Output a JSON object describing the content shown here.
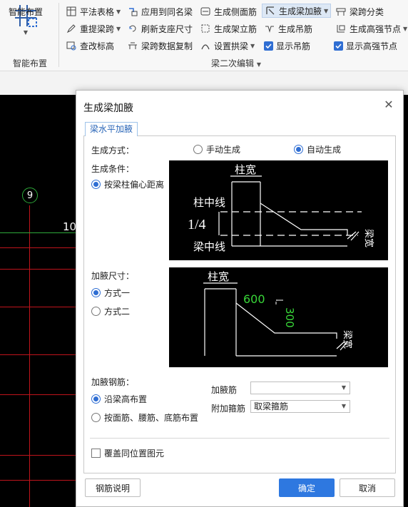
{
  "ribbon": {
    "big_button": {
      "label": "智能布置"
    },
    "group_smart_label": "智能布置",
    "group_edit_label": "梁二次编辑",
    "row1": [
      {
        "label": "平法表格",
        "has_dropdown": true
      },
      {
        "label": "应用到同名梁",
        "has_dropdown": false
      },
      {
        "label": "生成侧面筋",
        "has_dropdown": false
      },
      {
        "label": "生成梁加腋",
        "has_dropdown": true,
        "active": true
      },
      {
        "label": "梁跨分类",
        "has_dropdown": false
      }
    ],
    "row2": [
      {
        "label": "重提梁跨",
        "has_dropdown": true
      },
      {
        "label": "刷新支座尺寸",
        "has_dropdown": false
      },
      {
        "label": "生成架立筋",
        "has_dropdown": false
      },
      {
        "label": "生成吊筋",
        "has_dropdown": false
      },
      {
        "label": "生成高强节点",
        "has_dropdown": true
      }
    ],
    "row3": [
      {
        "label": "查改标高",
        "has_dropdown": false
      },
      {
        "label": "梁跨数据复制",
        "has_dropdown": false
      },
      {
        "label": "设置拱梁",
        "has_dropdown": true
      },
      {
        "label": "显示吊筋",
        "checked": true
      },
      {
        "label": "显示高强节点",
        "checked": true
      }
    ]
  },
  "canvas": {
    "axis_label": "9",
    "axis_number": "10"
  },
  "dialog": {
    "title": "生成梁加腋",
    "tab": "梁水平加腋",
    "gen_mode": {
      "label": "生成方式：",
      "options": [
        "手动生成",
        "自动生成"
      ],
      "selected": "自动生成"
    },
    "gen_condition": {
      "label": "生成条件：",
      "option": "按梁柱偏心距离"
    },
    "diagram1": {
      "col_width": "柱宽",
      "col_centerline": "柱中线",
      "ratio": "1/4",
      "beam_centerline": "梁中线",
      "beam_text": "梁宽"
    },
    "haunch_size": {
      "label": "加腋尺寸：",
      "options": [
        "方式一",
        "方式二"
      ],
      "selected": "方式一"
    },
    "diagram2": {
      "col_width": "柱宽",
      "dim_h": "600",
      "dim_v": "300",
      "beam_text": "梁宽"
    },
    "haunch_rebar": {
      "label": "加腋钢筋：",
      "options": [
        "沿梁高布置",
        "按面筋、腰筋、底筋布置"
      ],
      "selected": "沿梁高布置"
    },
    "fields": {
      "haunch_bar_label": "加腋筋",
      "haunch_bar_value": "",
      "stirrup_label": "附加箍筋",
      "stirrup_value": "取梁箍筋"
    },
    "overwrite_label": "覆盖同位置图元",
    "buttons": {
      "explain": "钢筋说明",
      "ok": "确定",
      "cancel": "取消"
    }
  },
  "colors": {
    "accent": "#2e78e0",
    "cad_green": "#2eaa3a",
    "cad_red": "#c0141c"
  }
}
